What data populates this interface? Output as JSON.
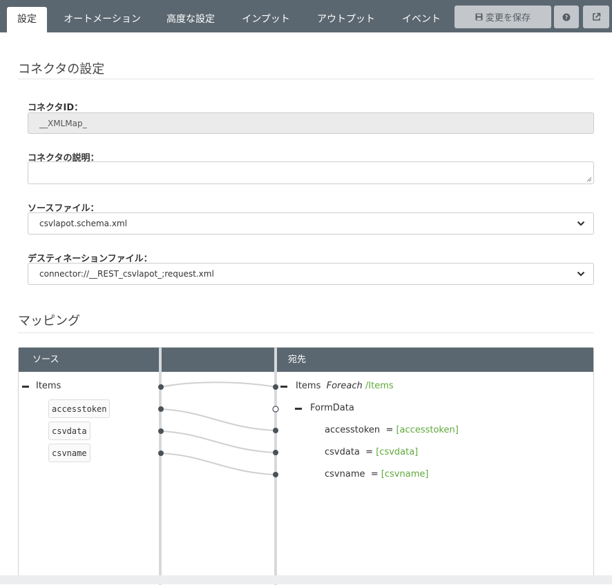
{
  "tabs": [
    {
      "label": "設定",
      "active": true
    },
    {
      "label": "オートメーション",
      "active": false
    },
    {
      "label": "高度な設定",
      "active": false
    },
    {
      "label": "インプット",
      "active": false
    },
    {
      "label": "アウトプット",
      "active": false
    },
    {
      "label": "イベント",
      "active": false
    }
  ],
  "toolbar": {
    "save_label": "変更を保存",
    "save_icon": "floppy-disk-icon",
    "help_icon": "question-circle-icon",
    "open_icon": "external-link-icon"
  },
  "connector_settings": {
    "title": "コネクタの設定",
    "id_label": "コネクタID：",
    "id_value": "__XMLMap_",
    "description_label": "コネクタの説明：",
    "description_value": "",
    "source_label": "ソースファイル：",
    "source_value": "csvlapot.schema.xml",
    "destination_label": "デスティネーションファイル：",
    "destination_value": "connector://__REST_csvlapot_;request.xml"
  },
  "mapping": {
    "title": "マッピング",
    "source_header": "ソース",
    "dest_header": "宛先",
    "source": {
      "root": "Items",
      "fields": [
        "accesstoken",
        "csvdata",
        "csvname"
      ]
    },
    "destination": {
      "root": "Items",
      "root_mode": "Foreach",
      "root_path": "/Items",
      "group": "FormData",
      "rows": [
        {
          "name": "accesstoken",
          "eq": "=",
          "value": "[accesstoken]"
        },
        {
          "name": "csvdata",
          "eq": "=",
          "value": "[csvdata]"
        },
        {
          "name": "csvname",
          "eq": "=",
          "value": "[csvname]"
        }
      ]
    }
  },
  "colors": {
    "header_bg": "#5b6770",
    "accent_green": "#5fa83b",
    "button_bg": "#c3c7cb"
  }
}
